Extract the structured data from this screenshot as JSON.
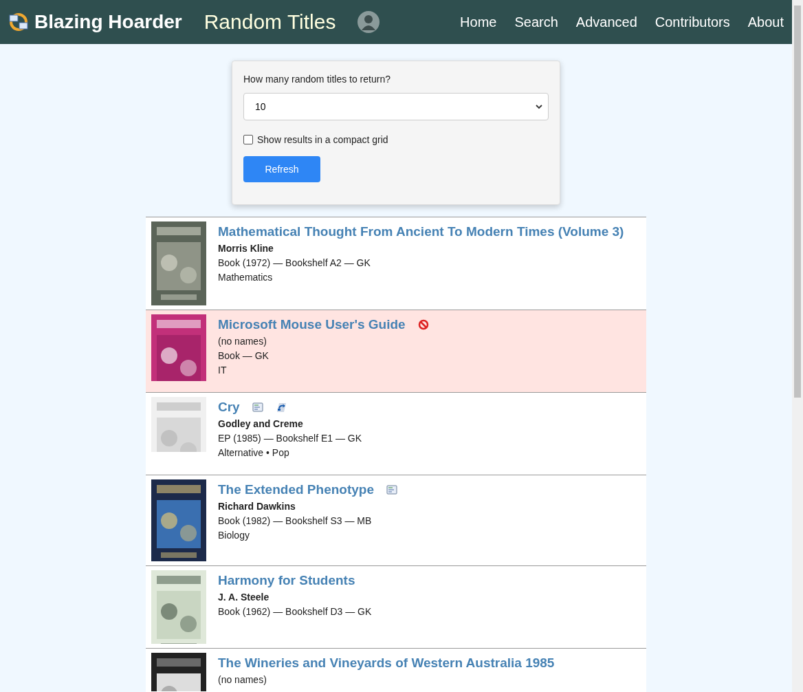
{
  "header": {
    "brand": "Blazing Hoarder",
    "page_title": "Random Titles",
    "nav": [
      {
        "label": "Home"
      },
      {
        "label": "Search"
      },
      {
        "label": "Advanced"
      },
      {
        "label": "Contributors"
      },
      {
        "label": "About"
      }
    ]
  },
  "form": {
    "question": "How many random titles to return?",
    "count": "10",
    "compact_label": "Show results in a compact grid",
    "compact": false,
    "button": "Refresh"
  },
  "results": [
    {
      "title": "Mathematical Thought From Ancient To Modern Times (Volume 3)",
      "flagged": false,
      "author": {
        "kind": "names",
        "text": "Morris Kline"
      },
      "details": "Book (1972) — Bookshelf A2 — GK",
      "categories": "Mathematics",
      "cover": {
        "kind": "picture"
      }
    },
    {
      "title": "Microsoft Mouse User's Guide",
      "flagged": true,
      "icons": [
        {
          "kind": "blocked"
        }
      ],
      "author": {
        "kind": "none",
        "text": "(no names)"
      },
      "details": "Book — GK",
      "categories": "IT",
      "cover": {
        "kind": "picture"
      }
    },
    {
      "title": "Cry",
      "flagged": false,
      "icons": [
        {
          "kind": "document"
        },
        {
          "kind": "music"
        }
      ],
      "author": {
        "kind": "names",
        "text": "Godley and Creme"
      },
      "details": "EP (1985) — Bookshelf E1 — GK",
      "categories": "Alternative • Pop",
      "cover": {
        "kind": "picture"
      }
    },
    {
      "title": "The Extended Phenotype",
      "flagged": false,
      "icons": [
        {
          "kind": "document"
        }
      ],
      "author": {
        "kind": "names",
        "text": "Richard Dawkins"
      },
      "details": "Book (1982) — Bookshelf S3 — MB",
      "categories": "Biology",
      "cover": {
        "kind": "picture"
      }
    },
    {
      "title": "Harmony for Students",
      "flagged": false,
      "author": {
        "kind": "names",
        "text": "J. A. Steele"
      },
      "details": "Book (1962) — Bookshelf D3 — GK",
      "cover": {
        "kind": "picture"
      }
    },
    {
      "title": "The Wineries and Vineyards of Western Australia 1985",
      "flagged": false,
      "author": {
        "kind": "none",
        "text": "(no names)"
      },
      "cover": {
        "kind": "picture"
      }
    }
  ]
}
